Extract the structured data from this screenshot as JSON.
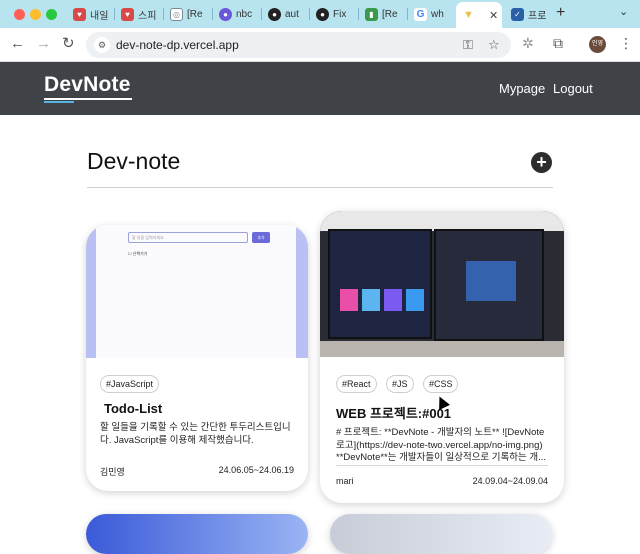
{
  "browser": {
    "tabs": [
      {
        "label": "내일",
        "icon": "heart-icon",
        "color": "#d84a4a"
      },
      {
        "label": "스피",
        "icon": "heart-icon",
        "color": "#d84a4a"
      },
      {
        "label": "[Re",
        "icon": "globe-icon",
        "color": "#7a8a99"
      },
      {
        "label": "nbc",
        "icon": "circle-icon",
        "color": "#6a58d8"
      },
      {
        "label": "aut",
        "icon": "github-icon",
        "color": "#222222"
      },
      {
        "label": "Fix",
        "icon": "github-icon",
        "color": "#222222"
      },
      {
        "label": "[Re",
        "icon": "book-icon",
        "color": "#3a9a4a"
      },
      {
        "label": "wh",
        "icon": "google-icon",
        "color": "#4285f4"
      },
      {
        "label": "",
        "icon": "vercel-icon",
        "color": "#e8c24a",
        "active": true
      },
      {
        "label": "프로",
        "icon": "bookmark-icon",
        "color": "#2b5fa8"
      }
    ],
    "new_tab": "+",
    "url": "dev-note-dp.vercel.app"
  },
  "header": {
    "logo": "DevNote",
    "nav": [
      "Mypage",
      "Logout"
    ]
  },
  "main": {
    "title": "Dev-note",
    "add_label": "+"
  },
  "cards": [
    {
      "thumb": "todo-screenshot",
      "tags": [
        "#JavaScript"
      ],
      "title": "Todo-List",
      "desc": "할 일들을 기록할 수 있는 간단한 투두리스트입니다. JavaScript를 이용해 제작했습니다.",
      "author": "김민영",
      "date": "24.06.05~24.06.19",
      "thumb_text": [
        "할 일을 입력하세요",
        "추가",
        "산책가기"
      ]
    },
    {
      "thumb": "monitor-photo",
      "tags": [
        "#React",
        "#JS",
        "#CSS"
      ],
      "title": "WEB 프로젝트:#001",
      "desc": "# 프로젝트: **DevNote - 개발자의 노트** ![DevNote 로고](https://dev-note-two.vercel.app/no-img.png) **DevNote**는 개발자들이 일상적으로 기록하는 개...",
      "author": "mari",
      "date": "24.09.04~24.09.04"
    }
  ],
  "colors": {
    "header_bg": "#3f4348",
    "accent": "#5ab4e0",
    "tabbar_bg": "#b8e4f0"
  }
}
